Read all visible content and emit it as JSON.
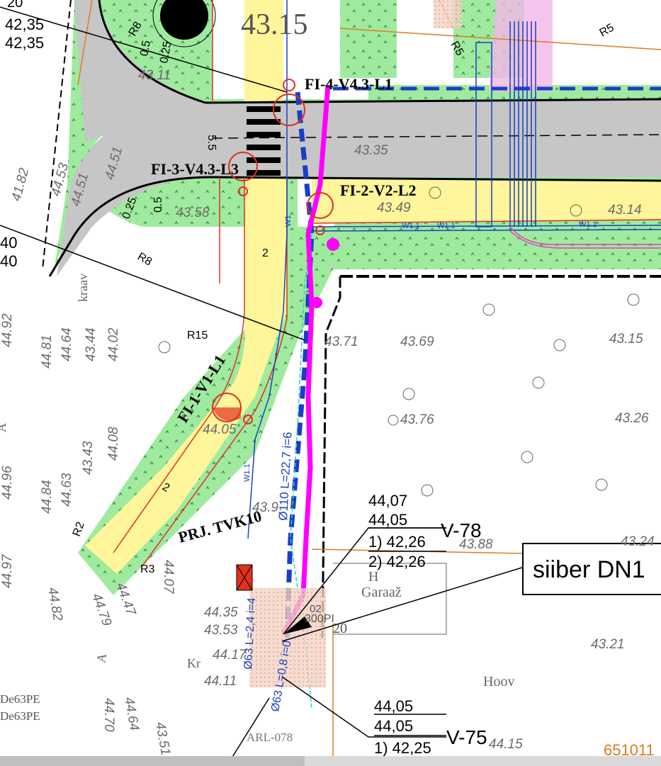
{
  "plot_title_number": "43.15",
  "top_left_values": [
    "20",
    "42,35",
    "42,35"
  ],
  "left_values": [
    "40",
    "40"
  ],
  "fire_hydrant_labels": [
    "FI-4-V4.3-L1",
    "FI-3-V4.3-L3",
    "FI-2-V2-L2",
    "FI-1-V1-L1"
  ],
  "project_label": "PRJ. TVK10",
  "radius_labels": [
    "R8",
    "R5",
    "R5",
    "R8",
    "R15",
    "R2",
    "R3"
  ],
  "dimension_labels": [
    "0.5",
    "0.25",
    "5.5",
    "0.5",
    "0.25",
    "2",
    "2",
    "2.0"
  ],
  "elevations": [
    "43.11",
    "43.35",
    "43.58",
    "43.49",
    "43.14",
    "43.71",
    "43.69",
    "43.15",
    "43.76",
    "43.26",
    "44.05",
    "43.88",
    "43.24",
    "43.21",
    "44.15",
    "43.9",
    "44.35",
    "43.53",
    "44.11",
    "44.17",
    "44.07"
  ],
  "left_elevations": [
    "44.92",
    "44.81",
    "44.64",
    "43.44",
    "44.02",
    "44.96",
    "44.84",
    "44.63",
    "43.43",
    "44.08",
    "44.97",
    "44.82",
    "44.79",
    "44.47",
    "44.64",
    "44.70",
    "44.51",
    "41.82",
    "44.53",
    "44.51",
    "43.51"
  ],
  "pipe_labels": [
    "Ø110 L=22,7 i=6",
    "Ø63 L=2,4 i=4",
    "Ø63 L=0,8 i=0",
    "W1.1",
    "W1.1",
    "W1.1",
    "W1",
    "W1.1"
  ],
  "word_labels": {
    "kraav": "kraav",
    "garage": "Garaaž",
    "yard": "Hoov",
    "kr": "Kr",
    "h": "H",
    "a1": "A",
    "a2": "A",
    "de63_1": "De63PE",
    "de63_2": "De63PE",
    "arl": "ARL-078",
    "n300": "300PI",
    "n20": "20",
    "n02": "02",
    "ar": "A"
  },
  "callout_v78": {
    "code": "V-78",
    "lines": [
      "44,07",
      "44,05",
      "1) 42,26",
      "2) 42,26"
    ]
  },
  "callout_v75": {
    "code": "V-75",
    "lines": [
      "44,05",
      "44,05",
      "1) 42,25"
    ]
  },
  "valve_label": "siiber DN1",
  "corner_number": "651011",
  "colors": {
    "green_zone": "#9be89b",
    "road": "#c8c8c8",
    "sidewalk": "#fff59a",
    "pipe_blue": "#1a3fc4",
    "magenta": "#ff00ff",
    "red": "#e0301e",
    "orange": "#e07a1f",
    "cyan": "#28d0d0",
    "pink_zone": "#f2b7e8"
  }
}
